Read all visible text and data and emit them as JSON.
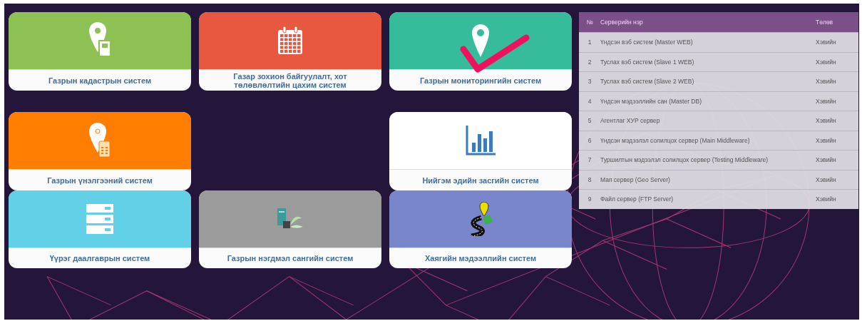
{
  "tile_rows": [
    {
      "tiles": [
        {
          "kind": "pin-doc",
          "color": "#8dc153",
          "label": "Газрын кадастрын систем",
          "checked": false
        },
        {
          "kind": "calendar",
          "color": "#e8573f",
          "label": "Газар зохион байгуулалт, хот төлөвлөлтийн цахим систем",
          "checked": false
        },
        {
          "kind": "pin",
          "color": "#37bc9b",
          "label": "Газрын мониторингийн систем",
          "checked": true
        }
      ]
    },
    {
      "tiles": [
        {
          "kind": "pin-calc",
          "color": "#ff7d00",
          "label": "Газрын үнэлгээний систем",
          "checked": false
        },
        {
          "kind": "chart",
          "color": "#ffffff",
          "label": "Нийгэм эдийн засгийн систем",
          "checked": false
        }
      ]
    },
    {
      "tiles": [
        {
          "kind": "server",
          "color": "#62d1e8",
          "label": "Үүрэг даалгаврын систем",
          "checked": false
        },
        {
          "kind": "pc-plant",
          "color": "#9b9b9b",
          "label": "Газрын нэгдмэл сангийн систем",
          "checked": false
        },
        {
          "kind": "road",
          "color": "#7986cc",
          "label": "Хаягийн мэдээллийн систем",
          "checked": false
        }
      ]
    }
  ],
  "servers": {
    "columns": [
      "№",
      "Серверийн нэр",
      "Төлөв"
    ],
    "rows": [
      [
        "1",
        "Үндсэн вэб систем (Master WEB)",
        "Хэвийн"
      ],
      [
        "2",
        "Туслах вэб систем (Slave 1 WEB)",
        "Хэвийн"
      ],
      [
        "3",
        "Туслах вэб систем (Slave 2 WEB)",
        "Хэвийн"
      ],
      [
        "4",
        "Үндсэн мэдээллийн сан (Master DB)",
        "Хэвийн"
      ],
      [
        "5",
        "Агентлаг ХУР сервер",
        "Хэвийн"
      ],
      [
        "6",
        "Үндсэн мэдээлэл солилцох сервер (Main Middleware)",
        "Хэвийн"
      ],
      [
        "7",
        "Туршилтын мэдээлэл солилцох сервер (Testing Middleware)",
        "Хэвийн"
      ],
      [
        "8",
        "Мап сервер (Geo Server)",
        "Хэвийн"
      ],
      [
        "9",
        "Файл сервер (FTP Server)",
        "Хэвийн"
      ]
    ]
  }
}
